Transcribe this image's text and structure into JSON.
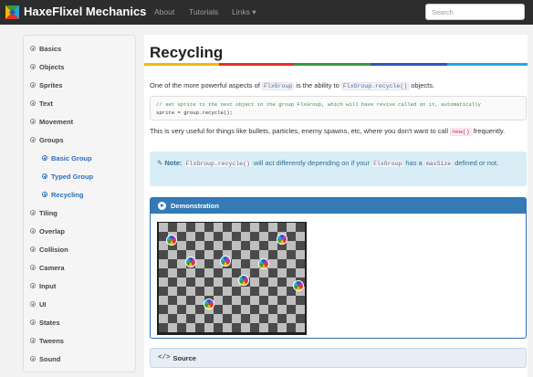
{
  "navbar": {
    "brand": "HaxeFlixel Mechanics",
    "links": [
      "About",
      "Tutorials",
      "Links ▾"
    ],
    "search_placeholder": "Search"
  },
  "sidebar": {
    "items": [
      {
        "label": "Basics",
        "sub": false
      },
      {
        "label": "Objects",
        "sub": false
      },
      {
        "label": "Sprites",
        "sub": false
      },
      {
        "label": "Text",
        "sub": false
      },
      {
        "label": "Movement",
        "sub": false
      },
      {
        "label": "Groups",
        "sub": false
      },
      {
        "label": "Basic Group",
        "sub": true
      },
      {
        "label": "Typed Group",
        "sub": true
      },
      {
        "label": "Recycling",
        "sub": true
      },
      {
        "label": "Tiling",
        "sub": false
      },
      {
        "label": "Overlap",
        "sub": false
      },
      {
        "label": "Collision",
        "sub": false
      },
      {
        "label": "Camera",
        "sub": false
      },
      {
        "label": "Input",
        "sub": false
      },
      {
        "label": "UI",
        "sub": false
      },
      {
        "label": "States",
        "sub": false
      },
      {
        "label": "Tweens",
        "sub": false
      },
      {
        "label": "Sound",
        "sub": false
      }
    ]
  },
  "main": {
    "title": "Recycling",
    "intro": {
      "before": "One of the more powerful aspects of ",
      "code1": "FlxGroup",
      "mid": " is the ability to ",
      "code2": "FlxGroup.recycle()",
      "after": " objects."
    },
    "code_lines": [
      "// set sprite to the next object in the group FlxGroup, which will have revive called on it, automatically",
      "sprite = group.recycle();"
    ],
    "usage": {
      "before": "This is very useful for things like bullets, particles, enemy spawns, etc, where you don't want to call ",
      "code": "new()",
      "after": " frequently."
    },
    "note": {
      "label": "Note:",
      "code1": "FlxGroup.recycle()",
      "t1": " will act differently depending on if your ",
      "code2": "FlxGroup",
      "t2": " has a ",
      "code3": "maxSize",
      "t3": " defined or not."
    },
    "demo_label": "Demonstration",
    "source_label": "Source",
    "source_icon": "</>"
  },
  "colors": {
    "accent_bars": [
      "#f5b800",
      "#e9302a",
      "#3a9a3a",
      "#2b58b5",
      "#1fa8e0"
    ],
    "panel_blue": "#337ab7",
    "sub_link": "#2a6ebb"
  },
  "demo": {
    "checker_light": "#bfbfbf",
    "checker_dark": "#4a4a4a"
  }
}
